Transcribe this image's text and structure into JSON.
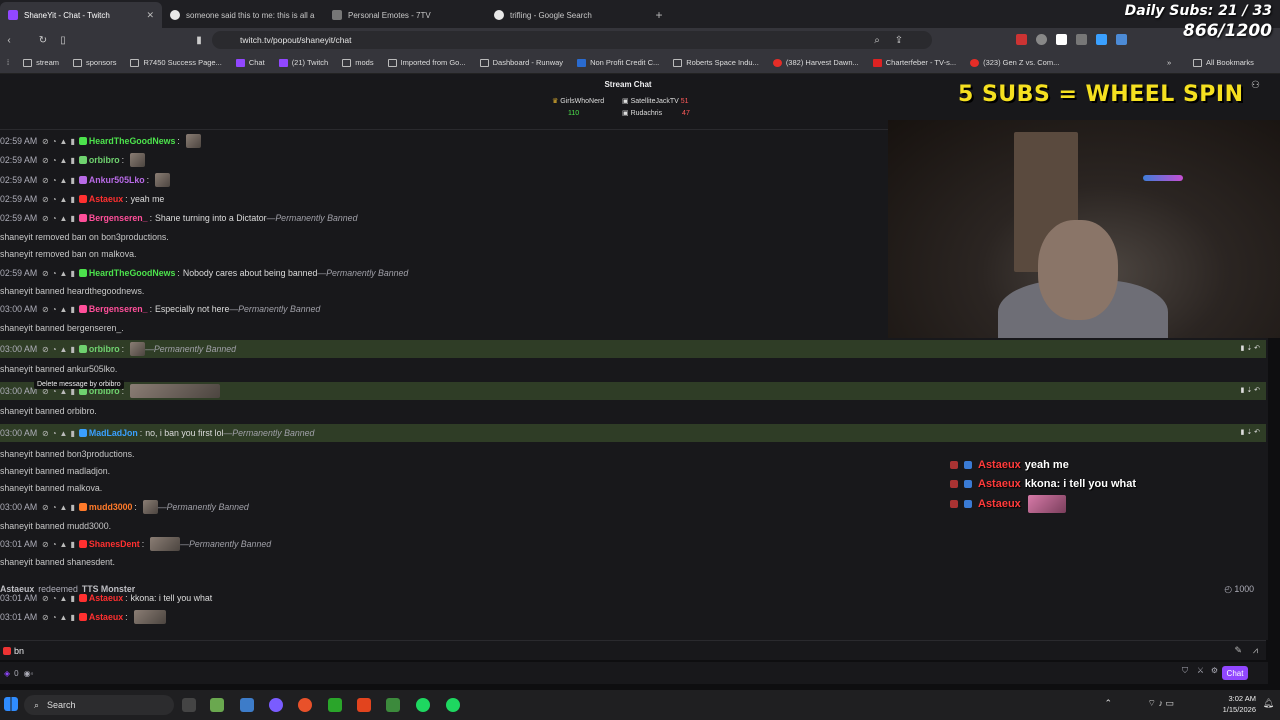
{
  "browser": {
    "tabs": [
      {
        "label": "ShaneYit - Chat - Twitch",
        "color": "#9147ff",
        "active": true
      },
      {
        "label": "someone said this to me: this is all a",
        "color": "#f5f5f5",
        "active": false
      },
      {
        "label": "Personal Emotes - 7TV",
        "color": "#7f7f7f",
        "active": false
      },
      {
        "label": "trifling - Google Search",
        "color": "#f5f5f5",
        "active": false
      }
    ],
    "url": "twitch.tv/popout/shaneyit/chat",
    "bookmarks": [
      "stream",
      "sponsors",
      "R7450 Success Page...",
      "Chat",
      "(21) Twitch",
      "mods",
      "Imported from Go...",
      "Dashboard - Runway",
      "Non Profit Credit C...",
      "Roberts Space Indu...",
      "(382) Harvest Dawn...",
      "Charterfeber - TV-s...",
      "(323) Gen Z vs. Com..."
    ],
    "all_bookmarks": "All Bookmarks"
  },
  "overlay": {
    "daily_subs": "Daily Subs: 21 / 33",
    "progress": "866/1200",
    "wheel": "5 SUBS = WHEEL SPIN"
  },
  "chat_header": {
    "title": "Stream Chat",
    "hype": [
      {
        "name": "GirlsWhoNerd",
        "count": "110"
      },
      {
        "name": "SatelliteJackTV",
        "count": "51"
      },
      {
        "name": "Rudachris",
        "count": "47"
      }
    ]
  },
  "messages": [
    {
      "ts": "02:59 AM",
      "user": "HeardTheGoodNews",
      "color": "#4ce24c",
      "text": "",
      "emote": true,
      "suffix": ""
    },
    {
      "ts": "02:59 AM",
      "user": "orbibro",
      "color": "#6fd26f",
      "text": "",
      "emote": true,
      "suffix": ""
    },
    {
      "ts": "02:59 AM",
      "user": "Ankur505Lko",
      "color": "#b86ae6",
      "text": "",
      "emote": true,
      "suffix": ""
    },
    {
      "ts": "02:59 AM",
      "user": "Astaeux",
      "color": "#ff3030",
      "text": "yeah me",
      "emote": false,
      "suffix": ""
    },
    {
      "ts": "02:59 AM",
      "user": "Bergenseren_",
      "color": "#ff4f9a",
      "text": "Shane turning into a Dictator",
      "emote": false,
      "suffix": "—Permanently Banned"
    },
    {
      "system": "shaneyit removed ban on bon3productions."
    },
    {
      "system": "shaneyit removed ban on malkova."
    },
    {
      "ts": "02:59 AM",
      "user": "HeardTheGoodNews",
      "color": "#4ce24c",
      "text": "Nobody cares about being banned",
      "emote": false,
      "suffix": "—Permanently Banned"
    },
    {
      "system": "shaneyit banned heardthegoodnews."
    },
    {
      "ts": "03:00 AM",
      "user": "Bergenseren_",
      "color": "#ff4f9a",
      "text": "Especially not here",
      "emote": false,
      "suffix": "—Permanently Banned"
    },
    {
      "system": "shaneyit banned bergenseren_."
    },
    {
      "ts": "03:00 AM",
      "user": "orbibro",
      "color": "#6fd26f",
      "text": "",
      "emote": true,
      "suffix": "—Permanently Banned"
    },
    {
      "system": "shaneyit banned ankur505lko."
    },
    {
      "ts": "03:00 AM",
      "user": "orbibro",
      "color": "#6fd26f",
      "text": "",
      "emote": true,
      "suffix": ""
    },
    {
      "system": "shaneyit banned orbibro."
    },
    {
      "ts": "03:00 AM",
      "user": "MadLadJon",
      "color": "#3aa0ff",
      "text": "no, i ban you first lol",
      "emote": false,
      "suffix": "—Permanently Banned"
    },
    {
      "system": "shaneyit banned bon3productions."
    },
    {
      "system": "shaneyit banned madladjon."
    },
    {
      "system": "shaneyit banned malkova."
    },
    {
      "ts": "03:00 AM",
      "user": "mudd3000",
      "color": "#ff7a2a",
      "text": "",
      "emote": true,
      "suffix": "—Permanently Banned"
    },
    {
      "system": "shaneyit banned mudd3000."
    },
    {
      "ts": "03:01 AM",
      "user": "ShanesDent",
      "color": "#ff3030",
      "text": "",
      "emote": true,
      "suffix": "—Permanently Banned"
    },
    {
      "system": "shaneyit banned shanesdent."
    },
    {
      "ts": "03:01 AM",
      "user": "Astaeux",
      "color": "#ff3030",
      "text": "kkona: i tell you what",
      "emote": false,
      "suffix": ""
    },
    {
      "ts": "03:01 AM",
      "user": "Astaeux",
      "color": "#ff3030",
      "text": "",
      "emote": true,
      "suffix": ""
    }
  ],
  "tooltip": "Delete message by orbibro",
  "redemption": {
    "user": "Astaeux",
    "verb": "redeemed",
    "reward": "TTS Monster",
    "cost": "1000"
  },
  "tts_overlay": [
    {
      "user": "Astaeux",
      "text": "yeah me"
    },
    {
      "user": "Astaeux",
      "text": "kkona: i tell you what"
    },
    {
      "user": "Astaeux",
      "text": ""
    }
  ],
  "input": {
    "value": "bn",
    "points": "0",
    "chat_button": "Chat"
  },
  "taskbar": {
    "search": "Search",
    "time": "3:02 AM",
    "date": "1/15/2026"
  }
}
